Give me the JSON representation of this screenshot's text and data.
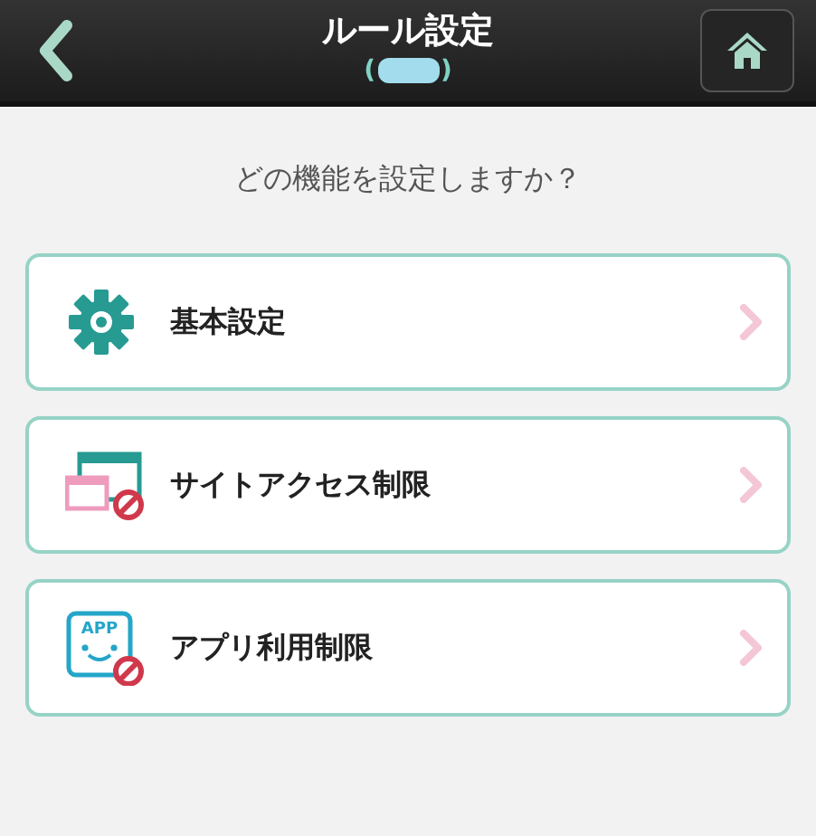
{
  "header": {
    "title": "ルール設定",
    "subtitle_open": "(",
    "subtitle_close": ")"
  },
  "prompt": "どの機能を設定しますか？",
  "menu": [
    {
      "kind": "settings",
      "label": "基本設定"
    },
    {
      "kind": "site",
      "label": "サイトアクセス制限"
    },
    {
      "kind": "app",
      "label": "アプリ利用制限",
      "icon_text": "APP"
    }
  ]
}
